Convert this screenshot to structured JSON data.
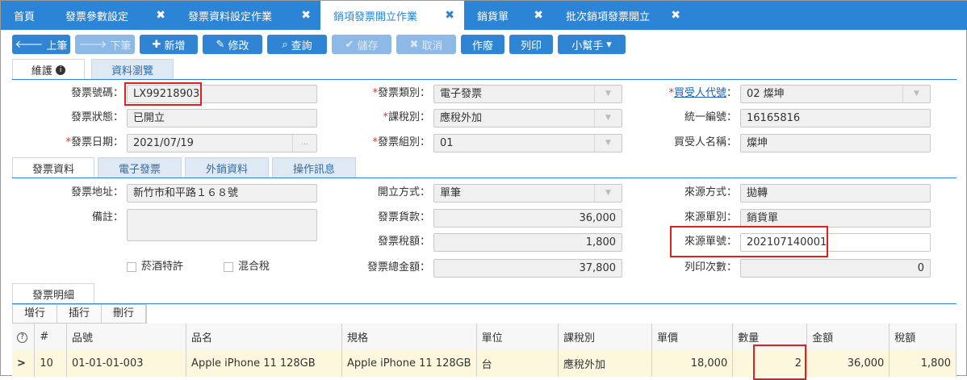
{
  "tabs": [
    {
      "label": "首頁",
      "closable": false
    },
    {
      "label": "發票參數設定",
      "closable": true
    },
    {
      "label": "發票資料設定作業",
      "closable": true
    },
    {
      "label": "銷項發票開立作業",
      "closable": true,
      "active": true
    },
    {
      "label": "銷貨單",
      "closable": true
    },
    {
      "label": "批次銷項發票開立",
      "closable": true
    }
  ],
  "close_glyph": "✖",
  "toolbar": {
    "prev": "上筆",
    "next": "下筆",
    "add": "新增",
    "edit": "修改",
    "query": "查詢",
    "save": "儲存",
    "cancel": "取消",
    "void": "作廢",
    "print": "列印",
    "helper": "小幫手"
  },
  "view_tabs": {
    "maintain": "維護",
    "browse": "資料瀏覽"
  },
  "header": {
    "invoice_no_label": "發票號碼",
    "invoice_no": "LX99218903",
    "status_label": "發票狀態",
    "status": "已開立",
    "date_label": "發票日期",
    "date": "2021/07/19",
    "date_btn": "...",
    "type_label": "發票類別",
    "type": "電子發票",
    "tax_label": "課稅別",
    "tax": "應稅外加",
    "group_label": "發票組別",
    "group": "01",
    "buyer_code_label": "買受人代號",
    "buyer_code": "02 燦坤",
    "unified_label": "統一編號",
    "unified": "16165816",
    "buyer_name_label": "買受人名稱",
    "buyer_name": "燦坤"
  },
  "info_tabs": {
    "invoice": "發票資料",
    "einvoice": "電子發票",
    "export": "外銷資料",
    "oplog": "操作訊息"
  },
  "info": {
    "address_label": "發票地址",
    "address": "新竹市和平路１６８號",
    "memo_label": "備註",
    "memo": "",
    "method_label": "開立方式",
    "method": "單筆",
    "amount_label": "發票貨款",
    "amount": "36,000",
    "taxamt_label": "發票稅額",
    "taxamt": "1,800",
    "total_label": "發票總金額",
    "total": "37,800",
    "src_type_label": "來源方式",
    "src_type": "拋轉",
    "src_doc_label": "來源單別",
    "src_doc": "銷貨單",
    "src_no_label": "來源單號",
    "src_no": "202107140001",
    "print_count_label": "列印次數",
    "print_count": "0",
    "tobacco_label": "菸酒特許",
    "mixed_label": "混合稅"
  },
  "detail": {
    "tab": "發票明細",
    "buttons": {
      "add": "增行",
      "insert": "插行",
      "delete": "刪行"
    },
    "columns": [
      "#",
      "品號",
      "品名",
      "規格",
      "單位",
      "課稅別",
      "單價",
      "數量",
      "金額",
      "稅額"
    ],
    "rows": [
      [
        "10",
        "01-01-01-003",
        "Apple iPhone 11 128GB",
        "Apple iPhone 11 128GB",
        "台",
        "應稅外加",
        "18,000",
        "2",
        "36,000",
        "1,800"
      ]
    ]
  },
  "icons": {
    "required": "*",
    "colon": "："
  }
}
